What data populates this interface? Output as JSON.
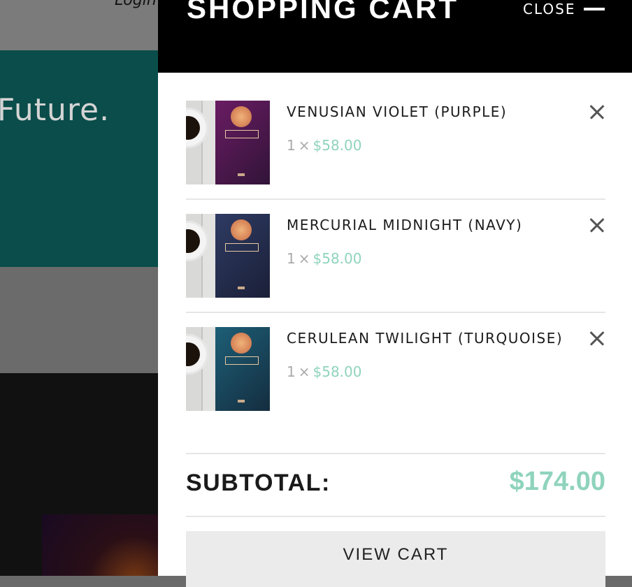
{
  "background": {
    "login_link": "Login",
    "hero_text": "Future."
  },
  "cart": {
    "title": "SHOPPING CART",
    "close_label": "CLOSE",
    "items": [
      {
        "name": "VENUSIAN VIOLET (PURPLE)",
        "qty": "1",
        "times": "×",
        "price": "$58.00",
        "book_color": "#6a1c63"
      },
      {
        "name": "MERCURIAL MIDNIGHT (NAVY)",
        "qty": "1",
        "times": "×",
        "price": "$58.00",
        "book_color": "#2e3b63"
      },
      {
        "name": "CERULEAN TWILIGHT (TURQUOISE)",
        "qty": "1",
        "times": "×",
        "price": "$58.00",
        "book_color": "#1d5f77"
      }
    ],
    "subtotal_label": "SUBTOTAL:",
    "subtotal_value": "$174.00",
    "view_cart_label": "VIEW CART"
  },
  "colors": {
    "accent": "#8fd3bd",
    "header_bg": "#000000",
    "hero_bg": "#0a4d4a"
  }
}
